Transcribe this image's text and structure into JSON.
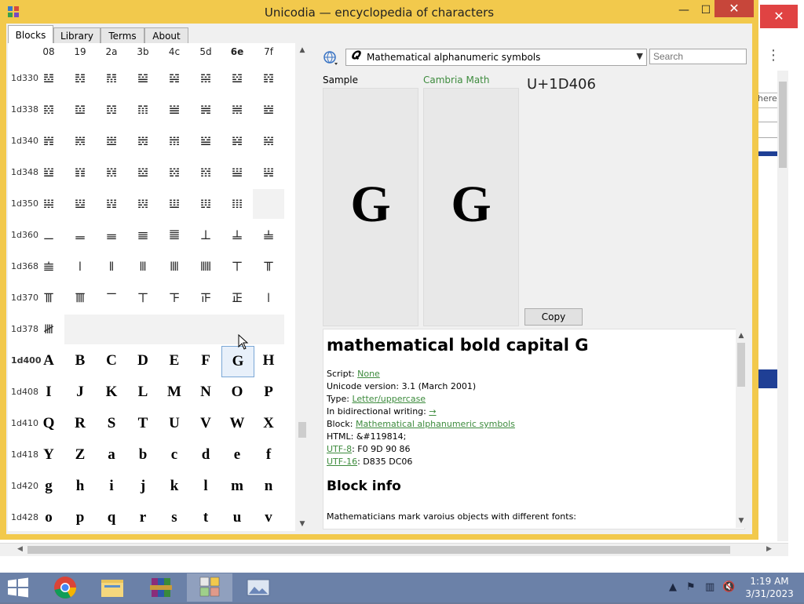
{
  "window": {
    "title": "Unicodia — encyclopedia of characters",
    "minimize": "—",
    "maximize": "☐",
    "close": "✕"
  },
  "background_window": {
    "close": "✕",
    "menu": "⋮",
    "field_text": "here"
  },
  "tabs": [
    "Blocks",
    "Library",
    "Terms",
    "About"
  ],
  "grid": {
    "columns": [
      "08",
      "19",
      "2a",
      "3b",
      "4c",
      "5d",
      "6e",
      "7f"
    ],
    "bold_column": "6e",
    "rows": [
      {
        "label": "1d330",
        "bold": false,
        "cells": [
          "𝌰",
          "𝌱",
          "𝌲",
          "𝌳",
          "𝌴",
          "𝌵",
          "𝌶",
          "𝌷"
        ]
      },
      {
        "label": "1d338",
        "bold": false,
        "cells": [
          "𝌸",
          "𝌹",
          "𝌺",
          "𝌻",
          "𝌼",
          "𝌽",
          "𝌾",
          "𝌿"
        ]
      },
      {
        "label": "1d340",
        "bold": false,
        "cells": [
          "𝍀",
          "𝍁",
          "𝍂",
          "𝍃",
          "𝍄",
          "𝍅",
          "𝍆",
          "𝍇"
        ]
      },
      {
        "label": "1d348",
        "bold": false,
        "cells": [
          "𝍈",
          "𝍉",
          "𝍊",
          "𝍋",
          "𝍌",
          "𝍍",
          "𝍎",
          "𝍏"
        ]
      },
      {
        "label": "1d350",
        "bold": false,
        "cells": [
          "𝍐",
          "𝍑",
          "𝍒",
          "𝍓",
          "𝍔",
          "𝍕",
          "𝍖",
          ""
        ]
      },
      {
        "label": "1d360",
        "bold": false,
        "cells": [
          "𝍠",
          "𝍡",
          "𝍢",
          "𝍣",
          "𝍤",
          "𝍥",
          "𝍦",
          "𝍧"
        ]
      },
      {
        "label": "1d368",
        "bold": false,
        "cells": [
          "𝍨",
          "𝍩",
          "𝍪",
          "𝍫",
          "𝍬",
          "𝍭",
          "𝍮",
          "𝍯"
        ]
      },
      {
        "label": "1d370",
        "bold": false,
        "cells": [
          "𝍰",
          "𝍱",
          "𝍲",
          "𝍳",
          "𝍴",
          "𝍵",
          "𝍶",
          "𝍷"
        ]
      },
      {
        "label": "1d378",
        "bold": false,
        "cells": [
          "𝍸",
          "",
          "",
          "",
          "",
          "",
          "",
          ""
        ]
      },
      {
        "label": "1d400",
        "bold": true,
        "cells": [
          "A",
          "B",
          "C",
          "D",
          "E",
          "F",
          "G",
          "H"
        ]
      },
      {
        "label": "1d408",
        "bold": false,
        "cells": [
          "I",
          "J",
          "K",
          "L",
          "M",
          "N",
          "O",
          "P"
        ]
      },
      {
        "label": "1d410",
        "bold": false,
        "cells": [
          "Q",
          "R",
          "S",
          "T",
          "U",
          "V",
          "W",
          "X"
        ]
      },
      {
        "label": "1d418",
        "bold": false,
        "cells": [
          "Y",
          "Z",
          "a",
          "b",
          "c",
          "d",
          "e",
          "f"
        ]
      },
      {
        "label": "1d420",
        "bold": false,
        "cells": [
          "g",
          "h",
          "i",
          "j",
          "k",
          "l",
          "m",
          "n"
        ]
      },
      {
        "label": "1d428",
        "bold": false,
        "cells": [
          "o",
          "p",
          "q",
          "r",
          "s",
          "t",
          "u",
          "v"
        ]
      }
    ],
    "selected": {
      "row": 9,
      "col": 6
    }
  },
  "detail": {
    "block_selector_icon": "𝑸",
    "block_selector": "Mathematical alphanumeric symbols",
    "search_placeholder": "Search",
    "sample_label": "Sample",
    "font_label": "Cambria Math",
    "codepoint": "U+1D406",
    "sample_glyph": "G",
    "font_glyph": "G",
    "copy_label": "Copy",
    "char_name": "mathematical bold capital G",
    "script_label": "Script: ",
    "script_value": "None",
    "version": "Unicode version: 3.1 (March 2001)",
    "type_label": "Type: ",
    "type_value": "Letter/uppercase",
    "bidi_label": "In bidirectional writing: ",
    "bidi_value": "→",
    "block_label": "Block: ",
    "block_value": "Mathematical alphanumeric symbols",
    "html": "HTML: &#119814;",
    "utf8_label": "UTF-8",
    "utf8_value": ": F0 9D 90 86",
    "utf16_label": "UTF-16",
    "utf16_value": ": D835 DC06",
    "block_info_title": "Block info",
    "block_info_text": "Mathematicians mark varoius objects with different fonts:"
  },
  "taskbar": {
    "time": "1:19 AM",
    "date": "3/31/2023"
  },
  "colors": {
    "title_bar": "#f2c94c",
    "close_button": "#c7463a",
    "link": "#3d8b3d",
    "taskbar": "#6b81a8"
  }
}
